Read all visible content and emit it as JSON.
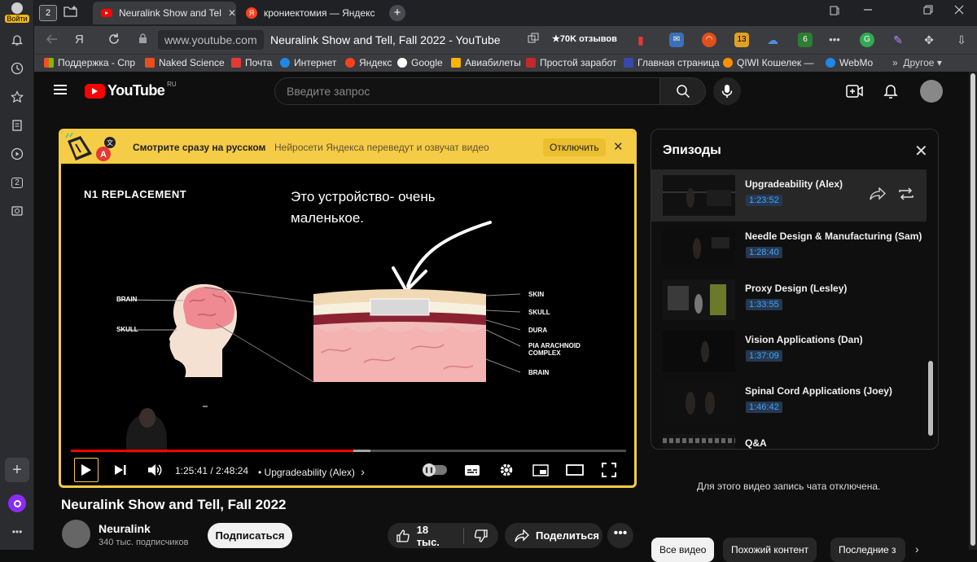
{
  "browser": {
    "login_label": "Войти",
    "tab_count": "2",
    "tabs": [
      {
        "title": "Neuralink Show and Tell",
        "close": "✕"
      },
      {
        "title": "крониектомия — Яндекс"
      }
    ],
    "url": "www.youtube.com",
    "page_title": "Neuralink Show and Tell, Fall 2022 - YouTube",
    "reviews": "★70K отзывов",
    "ext_badge": "13",
    "bookmarks": [
      "Поддержка - Спр",
      "Naked Science",
      "Почта",
      "Интернет",
      "Яндекс",
      "Google",
      "Авиабилеты",
      "Простой заработ",
      "Главная страница",
      "QIWI Кошелек —",
      "WebMo",
      "Другое"
    ]
  },
  "rail": {
    "badge": "2"
  },
  "youtube": {
    "logo_text": "YouTube",
    "logo_region": "RU",
    "search_placeholder": "Введите запрос"
  },
  "banner": {
    "title": "Смотрите сразу на русском",
    "subtitle": "Нейросети Яндекса переведут и озвучат видео",
    "off_button": "Отключить"
  },
  "slide": {
    "heading": "N1 REPLACEMENT",
    "caption_line1": "Это устройство- очень",
    "caption_line2": "маленькое.",
    "labels_left": [
      "BRAIN",
      "SKULL"
    ],
    "labels_right": [
      "SKIN",
      "SKULL",
      "DURA",
      "PIA ARACHNOID",
      "COMPLEX",
      "BRAIN"
    ]
  },
  "player": {
    "time": "1:25:41 / 2:48:24",
    "chapter": "• Upgradeability (Alex)",
    "chapter_arrow": "›",
    "progress": 0.509,
    "buffered": 0.54
  },
  "video": {
    "title": "Neuralink Show and Tell, Fall 2022",
    "channel": "Neuralink",
    "subscribers": "340 тыс. подписчиков",
    "subscribe": "Подписаться",
    "likes": "18 тыс.",
    "share": "Поделиться",
    "more": "•••"
  },
  "episodes": {
    "heading": "Эпизоды",
    "items": [
      {
        "name": "Upgradeability (Alex)",
        "time": "1:23:52"
      },
      {
        "name": "Needle Design & Manufacturing (Sam)",
        "time": "1:28:40"
      },
      {
        "name": "Proxy Design (Lesley)",
        "time": "1:33:55"
      },
      {
        "name": "Vision Applications (Dan)",
        "time": "1:37:09"
      },
      {
        "name": "Spinal Cord Applications (Joey)",
        "time": "1:46:42"
      },
      {
        "name": "Q&A",
        "time": ""
      }
    ]
  },
  "chat": {
    "disabled": "Для этого видео запись чата отключена."
  },
  "chips": [
    "Все видео",
    "Похожий контент",
    "Последние з"
  ],
  "colors": {
    "accent": "#f5cc46",
    "yt_red": "#ff0000",
    "link": "#3ea6ff"
  }
}
